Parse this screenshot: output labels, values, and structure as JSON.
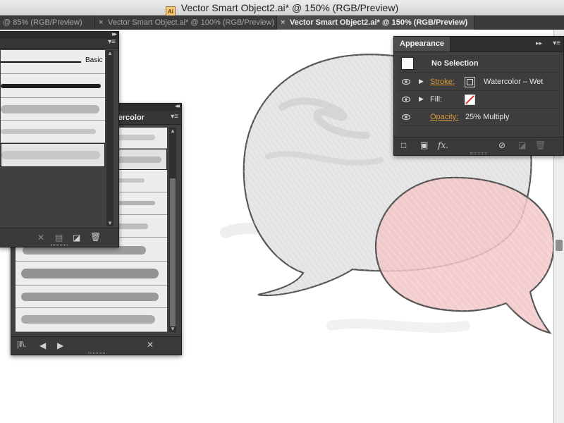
{
  "window": {
    "title": "Vector Smart Object2.ai* @ 150% (RGB/Preview)",
    "file_icon_label": "Ai"
  },
  "tabs": [
    {
      "label": "@ 85% (RGB/Preview)",
      "active": false
    },
    {
      "label": "Vector Smart Object.ai* @ 100% (RGB/Preview)",
      "active": false
    },
    {
      "label": "Vector Smart Object2.ai* @ 150% (RGB/Preview)",
      "active": true
    }
  ],
  "brushes_panel": {
    "basic_label": "Basic",
    "rows": [
      {
        "name": "basic-line"
      },
      {
        "name": "charcoal-brush"
      },
      {
        "name": "watercolor-wash-1"
      },
      {
        "name": "watercolor-wash-2"
      },
      {
        "name": "watercolor-wash-3",
        "selected": true
      }
    ]
  },
  "watercolor_library": {
    "title": "Watercolor",
    "visible_title": "tercolor",
    "row_count": 9,
    "selected_row": 1
  },
  "appearance": {
    "tab": "Appearance",
    "selection_label": "No Selection",
    "stroke": {
      "label": "Stroke:",
      "value": "Watercolor – Wet"
    },
    "fill": {
      "label": "Fill:"
    },
    "opacity": {
      "label": "Opacity:",
      "value": "25% Multiply"
    },
    "fx_label": "fx."
  },
  "colors": {
    "accent_link": "#d49a3a",
    "panel_bg": "#404040",
    "bubble_gray": "#e4e4e4",
    "bubble_pink": "#f3c7c7"
  }
}
